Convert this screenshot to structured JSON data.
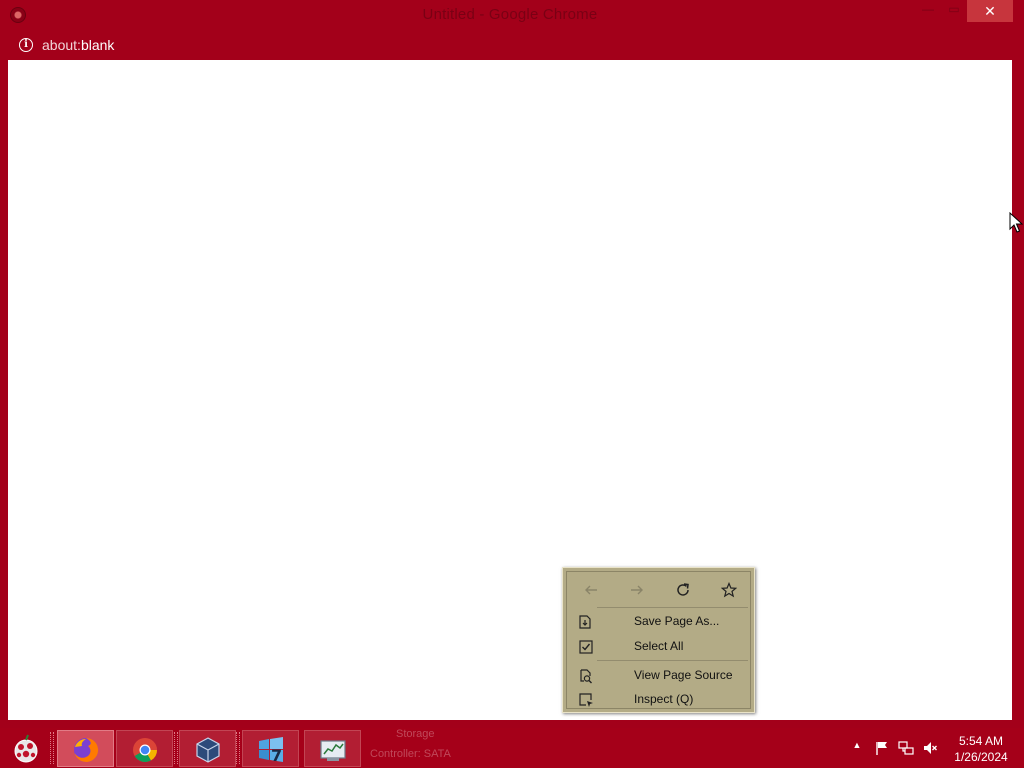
{
  "window": {
    "title": "Untitled - Google Chrome",
    "controls": {
      "minimize": "—",
      "maximize": "▭",
      "close": "✕"
    }
  },
  "address": {
    "scheme": "about:",
    "path": "blank"
  },
  "context_menu": {
    "nav": {
      "back_icon": "arrow-left-icon",
      "forward_icon": "arrow-right-icon",
      "reload_icon": "reload-icon",
      "bookmark_icon": "star-icon"
    },
    "items": [
      {
        "label": "Save Page As...",
        "icon": "save-page-icon"
      },
      {
        "label": "Select All",
        "icon": "select-all-icon"
      },
      {
        "label": "View Page Source",
        "icon": "view-source-icon"
      },
      {
        "label": "Inspect (Q)",
        "icon": "inspect-icon"
      }
    ]
  },
  "taskbar": {
    "ghost_labels": [
      "Storage",
      "Controller: SATA"
    ],
    "apps": [
      {
        "name": "Firefox",
        "icon": "firefox-icon",
        "active": true
      },
      {
        "name": "Google Chrome",
        "icon": "chrome-icon",
        "active": false
      },
      {
        "name": "VirtualBox",
        "icon": "virtualbox-icon",
        "active": false
      },
      {
        "name": "Windows 7",
        "icon": "windows7-vm-icon",
        "active": false
      },
      {
        "name": "Resource Monitor",
        "icon": "resource-monitor-icon",
        "active": false
      }
    ],
    "clock": {
      "time": "5:54 AM",
      "date": "1/26/2024"
    }
  },
  "colors": {
    "frame": "#a3001a",
    "close_button": "#c7353d",
    "menu_bg": "#b3ab86",
    "viewport": "#ffffff"
  }
}
